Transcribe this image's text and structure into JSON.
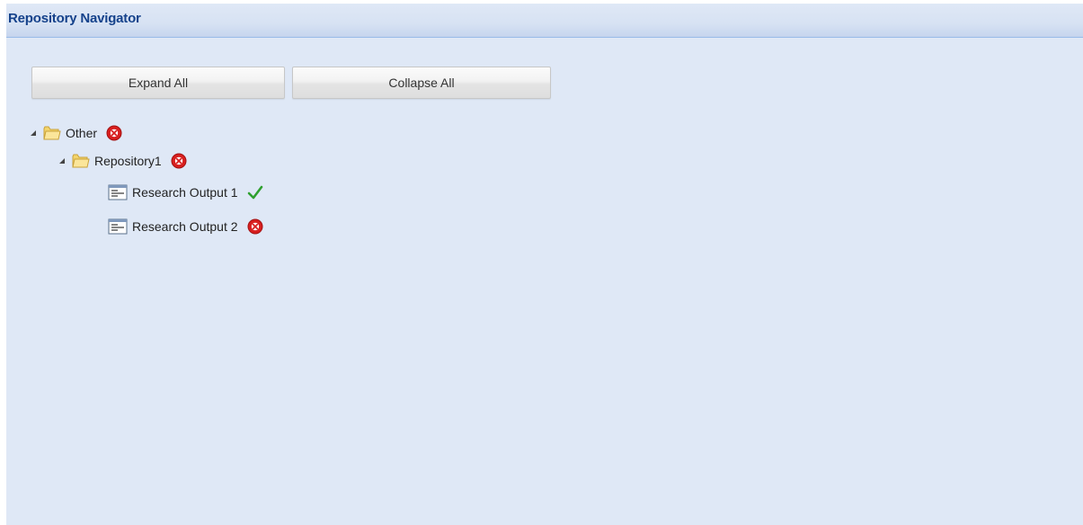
{
  "panel": {
    "title": "Repository Navigator"
  },
  "toolbar": {
    "expand_label": "Expand All",
    "collapse_label": "Collapse All"
  },
  "tree": {
    "nodes": [
      {
        "label": "Other",
        "kind": "folder",
        "expanded": true,
        "status": "error-icon"
      },
      {
        "label": "Repository1",
        "kind": "folder",
        "expanded": true,
        "status": "error-icon"
      },
      {
        "label": "Research Output 1",
        "kind": "document",
        "status": "check-icon"
      },
      {
        "label": "Research Output 2",
        "kind": "document",
        "status": "error-icon"
      }
    ]
  },
  "colors": {
    "panel_bg": "#dfe8f6",
    "title": "#15428b",
    "error": "#d81f1f",
    "success": "#2fa02f",
    "folder": "#f5d46a"
  }
}
